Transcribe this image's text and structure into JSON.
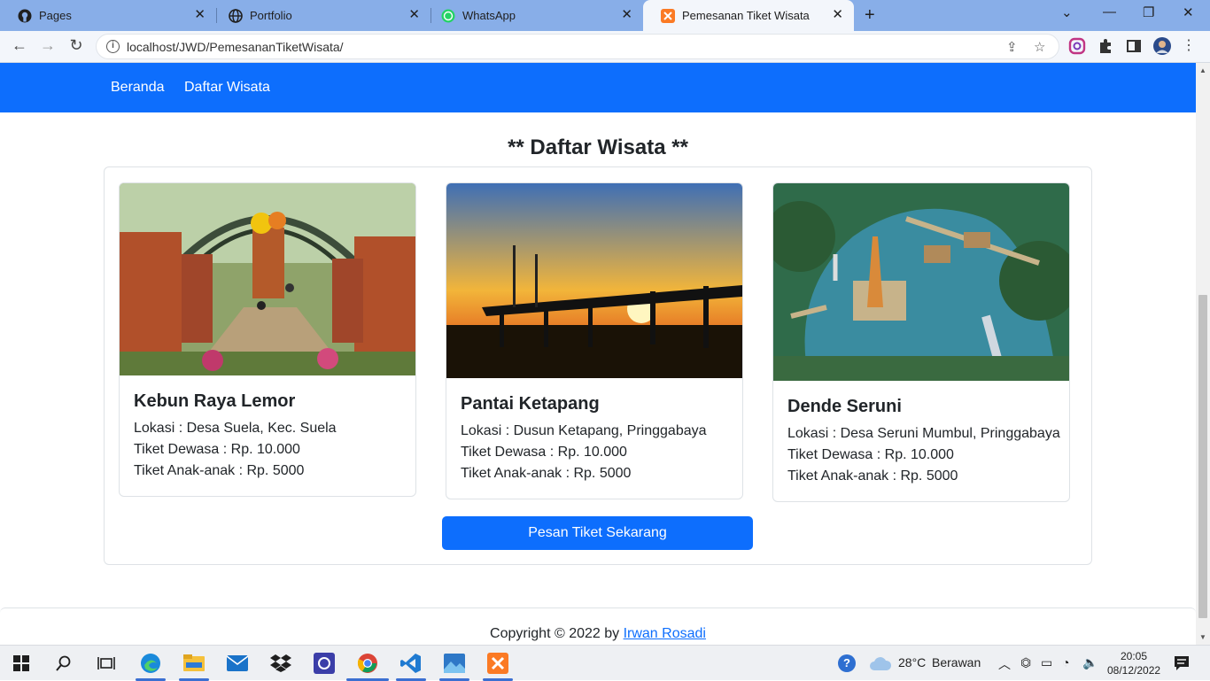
{
  "browser": {
    "tabs": [
      {
        "title": "Pages",
        "icon": "github-icon"
      },
      {
        "title": "Portfolio",
        "icon": "globe-icon"
      },
      {
        "title": "WhatsApp",
        "icon": "whatsapp-icon"
      },
      {
        "title": "Pemesanan Tiket Wisata",
        "icon": "xampp-icon"
      }
    ],
    "close_glyph": "✕",
    "newtab_glyph": "+",
    "url": "localhost/JWD/PemesananTiketWisata/"
  },
  "nav": {
    "items": [
      "Beranda",
      "Daftar Wisata"
    ]
  },
  "main": {
    "title": "** Daftar Wisata **",
    "cards": [
      {
        "name": "Kebun Raya Lemor",
        "lokasi": "Lokasi : Desa Suela, Kec. Suela",
        "dewasa": "Tiket Dewasa : Rp. 10.000",
        "anak": "Tiket Anak-anak : Rp. 5000"
      },
      {
        "name": "Pantai Ketapang",
        "lokasi": "Lokasi : Dusun Ketapang, Pringgabaya",
        "dewasa": "Tiket Dewasa : Rp. 10.000",
        "anak": "Tiket Anak-anak : Rp. 5000"
      },
      {
        "name": "Dende Seruni",
        "lokasi": "Lokasi : Desa Seruni Mumbul, Pringgabaya",
        "dewasa": "Tiket Dewasa : Rp. 10.000",
        "anak": "Tiket Anak-anak : Rp. 5000"
      }
    ],
    "button": "Pesan Tiket Sekarang"
  },
  "footer": {
    "text": "Copyright © 2022 by ",
    "author": "Irwan Rosadi"
  },
  "taskbar": {
    "weather_temp": "28°C",
    "weather_desc": "Berawan",
    "time": "20:05",
    "date": "08/12/2022"
  },
  "colors": {
    "primary": "#0d6efd",
    "tabbar": "#88aee8"
  }
}
